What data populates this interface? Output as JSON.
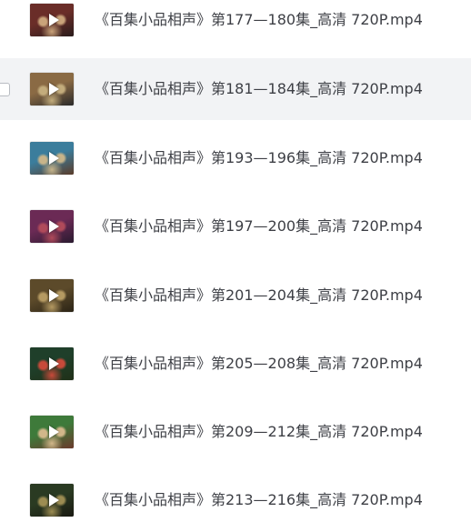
{
  "files": [
    {
      "name": "《百集小品相声》第177—180集_高清 720P.mp4",
      "thumb_colors": [
        "#6a2d28",
        "#c9a37a",
        "#2a1c1c"
      ],
      "thumb_icon": "play-icon"
    },
    {
      "name": "《百集小品相声》第181—184集_高清 720P.mp4",
      "thumb_colors": [
        "#8a6a44",
        "#c3ac7c",
        "#2b2a2a"
      ],
      "thumb_icon": "play-icon"
    },
    {
      "name": "《百集小品相声》第193—196集_高清 720P.mp4",
      "thumb_colors": [
        "#3b7d9c",
        "#c7b48a",
        "#5b3c2a"
      ],
      "thumb_icon": "play-icon"
    },
    {
      "name": "《百集小品相声》第197—200集_高清 720P.mp4",
      "thumb_colors": [
        "#6b2a55",
        "#b04a5a",
        "#2a1b30"
      ],
      "thumb_icon": "play-icon"
    },
    {
      "name": "《百集小品相声》第201—204集_高清 720P.mp4",
      "thumb_colors": [
        "#5c4a2a",
        "#b59a62",
        "#2b2416"
      ],
      "thumb_icon": "play-icon"
    },
    {
      "name": "《百集小品相声》第205—208集_高清 720P.mp4",
      "thumb_colors": [
        "#1f3f2a",
        "#c84a3a",
        "#203018"
      ],
      "thumb_icon": "play-icon"
    },
    {
      "name": "《百集小品相声》第209—212集_高清 720P.mp4",
      "thumb_colors": [
        "#3e7a3a",
        "#d2b78a",
        "#6b3a2c"
      ],
      "thumb_icon": "play-icon"
    },
    {
      "name": "《百集小品相声》第213—216集_高清 720P.mp4",
      "thumb_colors": [
        "#2a3a22",
        "#9c8c52",
        "#1a1a12"
      ],
      "thumb_icon": "play-icon"
    }
  ],
  "hovered_row": 1,
  "colors": {
    "hover_background": "#f2f3f5",
    "text": "#3d3f45"
  }
}
